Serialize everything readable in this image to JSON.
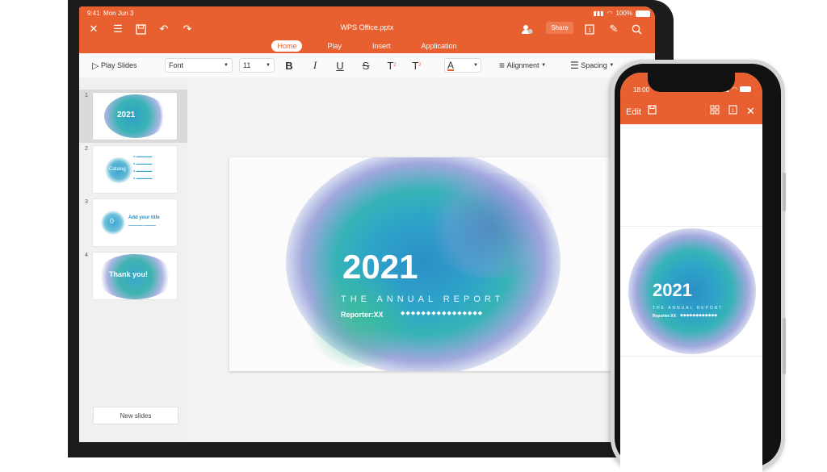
{
  "tablet": {
    "status": {
      "time": "9:41",
      "date": "Mon Jun 3",
      "battery": "100%"
    },
    "title": "WPS Office.pptx",
    "tabs": [
      {
        "label": "Home"
      },
      {
        "label": "Play"
      },
      {
        "label": "Insert"
      },
      {
        "label": "Application"
      }
    ],
    "share_label": "Share",
    "ribbon": {
      "play_slides": "Play Slides",
      "font": "Font",
      "font_size": "11",
      "alignment": "Alignment",
      "spacing": "Spacing"
    },
    "thumbnails": [
      {
        "num": "1",
        "title": "2021"
      },
      {
        "num": "2",
        "title": "Catalog"
      },
      {
        "num": "3",
        "num_text": "0",
        "title": "Add your title"
      },
      {
        "num": "4",
        "title": "Thank you!"
      }
    ],
    "new_slides": "New slides",
    "slide": {
      "year": "2021",
      "subtitle": "THE ANNUAL REPORT",
      "reporter": "Reporter:XX",
      "dots": "◆◆◆◆◆◆◆◆◆◆◆◆◆◆◆◆"
    }
  },
  "phone": {
    "time": "18:00",
    "edit_label": "Edit",
    "slide": {
      "year": "2021",
      "subtitle": "THE ANNUAL REPORT",
      "reporter": "Reporter:XX",
      "dots": "◆◆◆◆◆◆◆◆◆◆◆◆"
    }
  },
  "colors": {
    "accent": "#e8602f",
    "splash_blue": "#3aa6cf",
    "splash_teal": "#2fb3a0",
    "splash_purple": "#8a8fd0"
  }
}
